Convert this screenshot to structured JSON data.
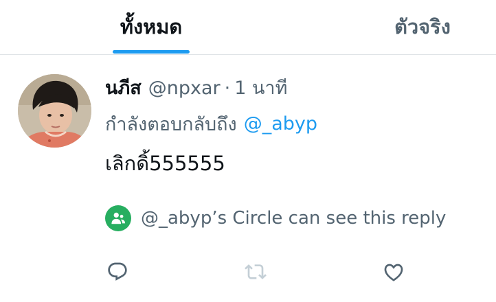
{
  "tabs": [
    {
      "label": "ทั้งหมด",
      "selected": true
    },
    {
      "label": "ตัวจริง",
      "selected": false
    }
  ],
  "colors": {
    "accent": "#1d9bf0",
    "circle_badge": "#27ae60",
    "secondary_text": "#536471",
    "primary_text": "#0f1419",
    "retweet_disabled": "#c4cfd6"
  },
  "post": {
    "display_name": "นภีส",
    "handle": "@npxar",
    "separator": "·",
    "time": "1 นาที",
    "reply_prefix": "กำลังตอบกลับถึง",
    "reply_to": "@_abyp",
    "text": "เลิกดิ้555555",
    "circle_notice": "@_abyp’s Circle can see this reply",
    "avatar_icon": "profile-photo",
    "circle_icon": "people-icon"
  },
  "actions": [
    {
      "name": "reply",
      "icon": "speech-bubble-icon",
      "enabled": true
    },
    {
      "name": "retweet",
      "icon": "retweet-arrows-icon",
      "enabled": false
    },
    {
      "name": "like",
      "icon": "heart-icon",
      "enabled": true
    }
  ]
}
